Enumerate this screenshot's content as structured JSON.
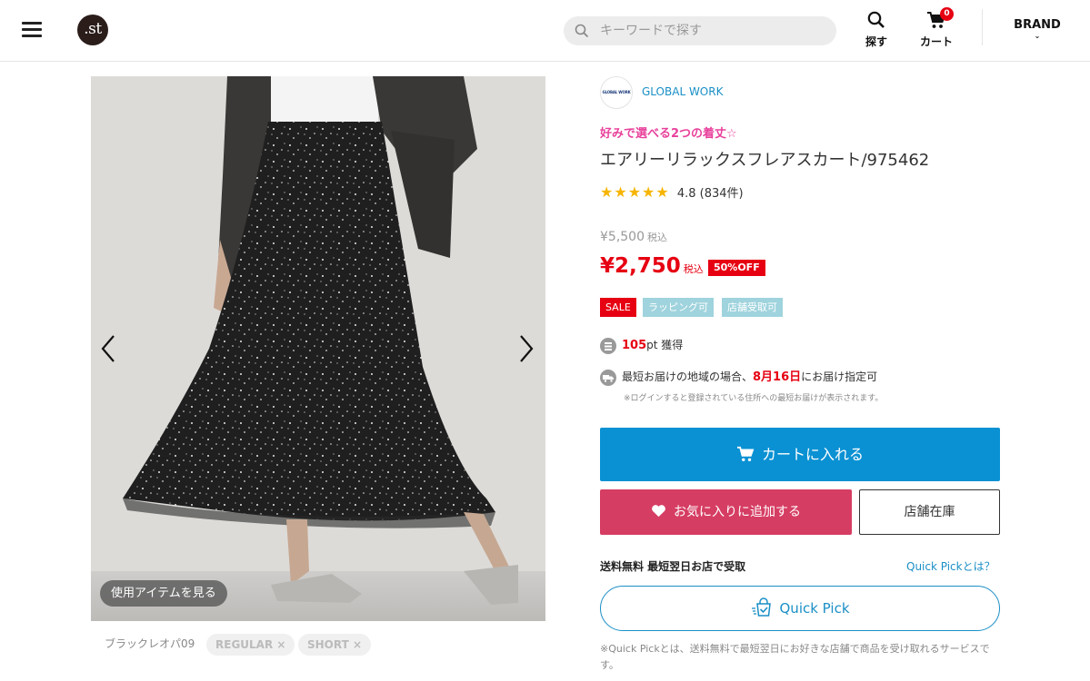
{
  "header": {
    "logo_text": ".st",
    "search_placeholder": "キーワードで探す",
    "search_label": "探す",
    "cart_label": "カート",
    "cart_count": "0",
    "brand_label": "BRAND"
  },
  "gallery": {
    "use_items_label": "使用アイテムを見る",
    "color_caption": "ブラックレオパ09",
    "chips": [
      "REGULAR ×",
      "SHORT ×"
    ]
  },
  "product": {
    "brand_logo_text": "GLOBAL WORK",
    "brand_name": "GLOBAL WORK",
    "catch_copy": "好みで選べる2つの着丈☆",
    "title": "エアリーリラックスフレアスカート/975462",
    "rating_stars": "★★★★★",
    "rating_text": "4.8 (834件)",
    "original_price": "¥5,500",
    "original_tax": "税込",
    "sale_price": "¥2,750",
    "sale_tax": "税込",
    "discount_badge": "50%OFF",
    "tags": [
      "SALE",
      "ラッピング可",
      "店舗受取可"
    ],
    "points_value": "105",
    "points_unit": "pt",
    "points_suffix": " 獲得",
    "delivery_prefix": "最短お届けの地域の場合、",
    "delivery_date": "8月16日",
    "delivery_suffix": "にお届け指定可",
    "delivery_note": "※ログインすると登録されている住所への最短お届けが表示されます。"
  },
  "actions": {
    "cart_button": "カートに入れる",
    "favorite_button": "お気に入りに追加する",
    "store_stock_button": "店舗在庫",
    "quickpick_heading": "送料無料 最短翌日お店で受取",
    "quickpick_link": "Quick Pickとは？",
    "quickpick_button": "Quick Pick",
    "quickpick_note": "※Quick Pickとは、送料無料で最短翌日にお好きな店舗で商品を受け取れるサービスです。"
  },
  "colors": {
    "accent_blue": "#0a91d3",
    "favorite_pink": "#d63d63",
    "sale_red": "#e60012",
    "catch_pink": "#e8419b",
    "tag_teal": "#9fd3dd"
  }
}
